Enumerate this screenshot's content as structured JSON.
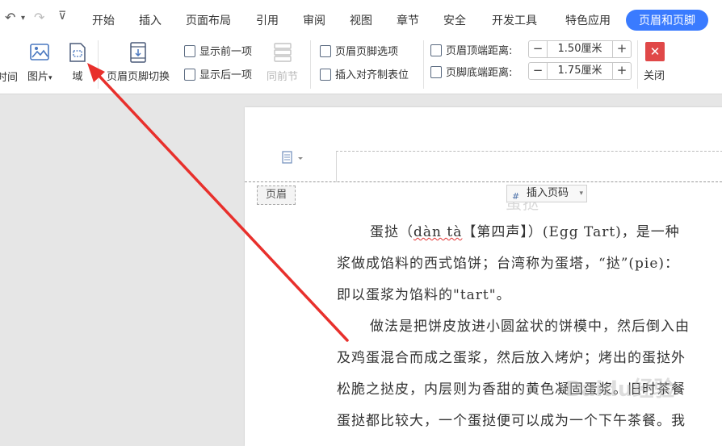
{
  "quick_access": {
    "undo": "↶",
    "undo_caret": "▾",
    "redo": "↷",
    "customize": "⊽"
  },
  "tabs": [
    "开始",
    "插入",
    "页面布局",
    "引用",
    "审阅",
    "视图",
    "章节",
    "安全",
    "开发工具",
    "特色应用",
    "页眉和页脚"
  ],
  "ribbon": {
    "time_label": "时间",
    "picture_label": "图片",
    "picture_caret": "▾",
    "field_label": "域",
    "switch_label": "页眉页脚切换",
    "show_prev": "显示前一项",
    "show_next": "显示后一项",
    "same_prev": "同前节",
    "options": "页眉页脚选项",
    "insert_tab": "插入对齐制表位",
    "top_dist_label": "页眉顶端距离:",
    "top_dist_value": "1.50厘米",
    "bottom_dist_label": "页脚底端距离:",
    "bottom_dist_value": "1.75厘米",
    "minus": "−",
    "plus": "+",
    "close_label": "关闭",
    "close_glyph": "✕"
  },
  "header": {
    "label": "页眉",
    "insert_page_num": "插入页码",
    "caret": "▾",
    "title_partial": "蛋挞"
  },
  "document": {
    "p1_l1a": "蛋挞（",
    "p1_l1b": "dàn tà",
    "p1_l1c": "【第四声】）(Egg Tart)，是一种",
    "p1_l2": "浆做成馅料的西式馅饼；台湾称为蛋塔，“挞”(pie)：",
    "p1_l3": "即以蛋浆为馅料的\"tart\"。",
    "p2_l1": "做法是把饼皮放进小圆盆状的饼模中，然后倒入由",
    "p2_l2": "及鸡蛋混合而成之蛋浆，然后放入烤炉；烤出的蛋挞外",
    "p2_l3": "松脆之挞皮，内层则为香甜的黄色凝固蛋浆。旧时茶餐",
    "p2_l4": "蛋挞都比较大，一个蛋挞便可以成为一个下午茶餐。我"
  },
  "watermark": "Baidu经验",
  "colors": {
    "accent": "#3a7bff",
    "arrow": "#e8302c",
    "close": "#e04848"
  }
}
